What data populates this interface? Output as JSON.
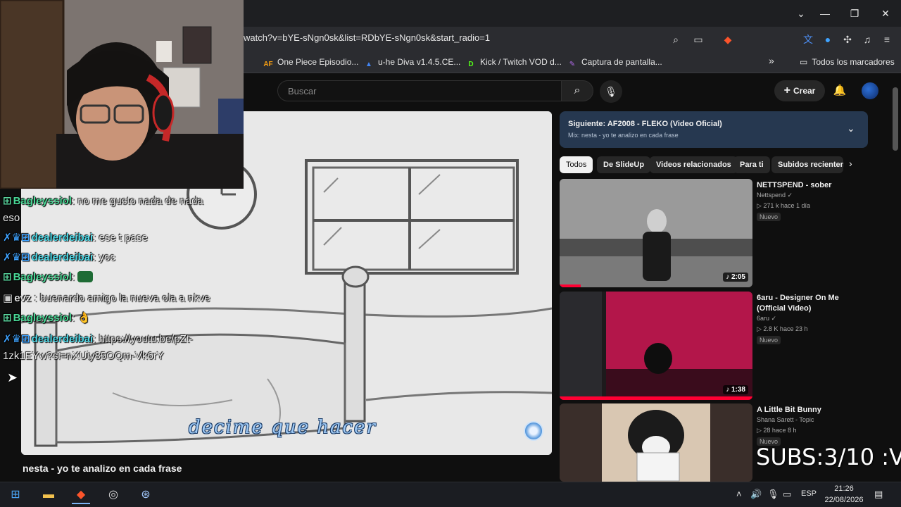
{
  "browser": {
    "url": "watch?v=bYE-sNgn0sk&list=RDbYE-sNgn0sk&start_radio=1",
    "window_controls": {
      "chevron": "⌄",
      "minimize": "—",
      "restore": "❐",
      "close": "✕"
    },
    "bookmarks": [
      {
        "label": "One Piece Episodio...",
        "icon": "AF",
        "color": "#f39c12"
      },
      {
        "label": "u-he Diva v1.4.5.CE...",
        "icon": "▲",
        "color": "#4285f4"
      },
      {
        "label": "Kick / Twitch VOD d...",
        "icon": "D",
        "color": "#53fc18"
      },
      {
        "label": "Captura de pantalla...",
        "icon": "✎",
        "color": "#b06ae8"
      }
    ],
    "bookmarks_more": "»",
    "all_bookmarks": "Todos los marcadores"
  },
  "youtube": {
    "search_placeholder": "Buscar",
    "create_label": "Crear",
    "video_title": "nesta - yo te analizo en cada frase",
    "subtitle": "decime que hacer",
    "queue": {
      "title": "Siguiente: AF2008 - FLEKO (Video Oficial)",
      "subtitle": "Mix: nesta - yo te analizo en cada frase"
    },
    "chips": [
      "Todos",
      "De SlideUp",
      "Videos relacionados",
      "Para ti",
      "Subidos recientem"
    ],
    "recommendations": [
      {
        "title": "NETTSPEND - sober",
        "channel": "Nettspend ✓",
        "meta": "▷ 271 k   hace 1 día",
        "badge": "Nuevo",
        "duration": "♪ 2:05"
      },
      {
        "title": "6aru - Designer On Me (Official Video)",
        "channel": "6aru ✓",
        "meta": "▷ 2.8 K   hace 23 h",
        "badge": "Nuevo",
        "duration": "♪ 1:38"
      },
      {
        "title": "A Little Bit Bunny",
        "channel": "Shana Sarett - Topic",
        "meta": "▷ 28   hace 8 h",
        "badge": "Nuevo",
        "duration": ""
      }
    ]
  },
  "chat": [
    {
      "badges": "⊞",
      "user": "Bagleyssiol",
      "message": "no me gusto nada de nada",
      "user_color": "green"
    },
    {
      "badges": "",
      "user": "",
      "message": "eso",
      "user_color": ""
    },
    {
      "badges": "✗♛⊞",
      "user": "dealerdeibai",
      "message": "ese t pase",
      "user_color": "cyan"
    },
    {
      "badges": "✗♛⊞",
      "user": "dealerdeibai",
      "message": "yoc",
      "user_color": "cyan"
    },
    {
      "badges": "⊞",
      "user": "Bagleyssiol",
      "message": "",
      "user_color": "green"
    },
    {
      "badges": "▣",
      "user": "evz",
      "message": "buenardo amigo la nueva ola a nkve",
      "user_color": "white"
    },
    {
      "badges": "⊞",
      "user": "Bagleyssiol",
      "message": "👌",
      "user_color": "green"
    },
    {
      "badges": "✗♛⊞",
      "user": "dealerdeibai",
      "message": "https://youtu.be/pZt-",
      "user_color": "cyan"
    },
    {
      "badges": "",
      "user": "",
      "message": "1zk1EYw?si=nXUiy85OQm-Vk6rY",
      "user_color": ""
    }
  ],
  "overlay": {
    "subs_counter": "SUBS:3/10 :V"
  },
  "taskbar": {
    "language": "ESP",
    "time": "21:26",
    "date": "22/08/2026"
  },
  "colors": {
    "queue_bg": "#263850",
    "accent_red": "#ff0033",
    "chat_cyan": "#4fd8e6",
    "chat_green": "#49d896"
  }
}
